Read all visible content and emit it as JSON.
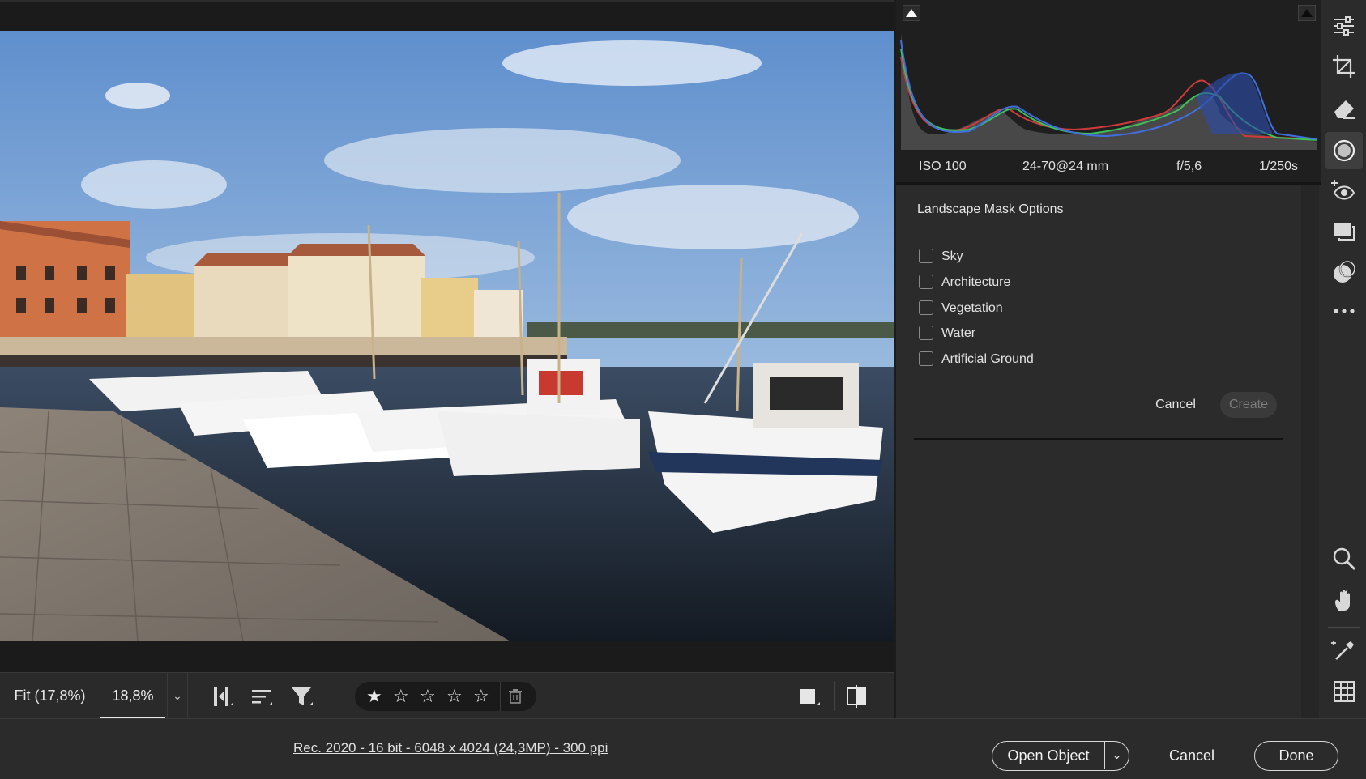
{
  "histogram": {
    "exif": {
      "iso": "ISO 100",
      "lens": "24-70@24 mm",
      "aperture": "f/5,6",
      "shutter": "1/250s"
    }
  },
  "mask_panel": {
    "title": "Landscape Mask Options",
    "options": [
      {
        "label": "Sky",
        "checked": false
      },
      {
        "label": "Architecture",
        "checked": false
      },
      {
        "label": "Vegetation",
        "checked": false
      },
      {
        "label": "Water",
        "checked": false
      },
      {
        "label": "Artificial Ground",
        "checked": false
      }
    ],
    "cancel_label": "Cancel",
    "create_label": "Create"
  },
  "viewer_toolbar": {
    "zoom_fit": "Fit (17,8%)",
    "zoom_current": "18,8%",
    "rating_stars": 1,
    "rating_max": 5
  },
  "status": {
    "image_info": "Rec. 2020 - 16 bit - 6048 x 4024 (24,3MP) - 300 ppi"
  },
  "actions": {
    "open_object": "Open Object",
    "cancel": "Cancel",
    "done": "Done"
  },
  "tools": [
    "edit-sliders-icon",
    "crop-icon",
    "eraser-icon",
    "masking-icon",
    "red-eye-icon",
    "snapshots-icon",
    "presets-icon",
    "more-icon",
    "zoom-icon",
    "hand-icon",
    "color-sampler-icon",
    "grid-icon"
  ]
}
